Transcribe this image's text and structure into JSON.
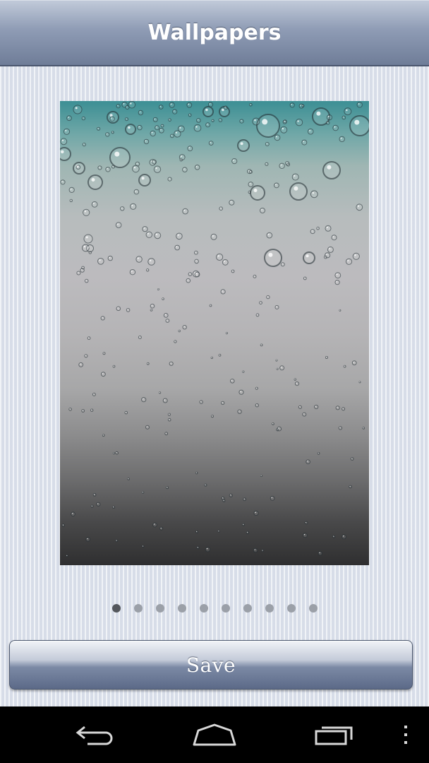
{
  "header": {
    "title": "Wallpapers"
  },
  "wallpaper": {
    "icon": "raindrops-wallpaper-image"
  },
  "pager": {
    "total_pages": 10,
    "current_page": 1
  },
  "actions": {
    "save_label": "Save"
  },
  "nav_bar": {
    "back_icon": "back-arrow-icon",
    "home_icon": "home-icon",
    "recents_icon": "recent-apps-icon",
    "menu_icon": "overflow-menu-icon"
  },
  "colors": {
    "title_bar": "#8f9cb5",
    "background": "#dfe4ee",
    "active_dot": "#54575c",
    "inactive_dot": "#9ba0a8"
  }
}
